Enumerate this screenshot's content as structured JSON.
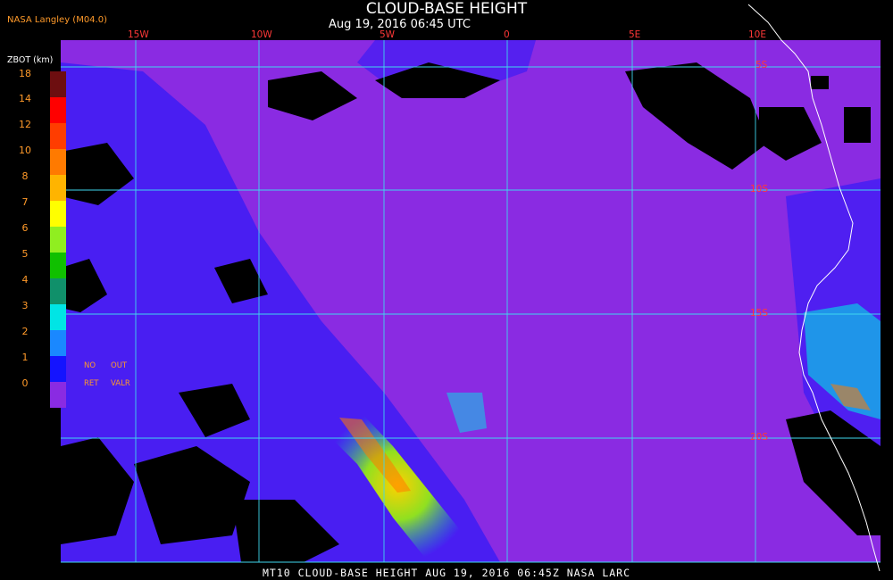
{
  "header": {
    "title": "CLOUD-BASE HEIGHT",
    "subtitle": "Aug 19, 2016 06:45 UTC",
    "source": "NASA Langley (M04.0)"
  },
  "footer": {
    "text": "MT10  CLOUD-BASE HEIGHT   AUG 19, 2016 06:45Z   NASA LARC"
  },
  "map": {
    "region": "South-East Atlantic / West Africa coast",
    "lon_labels": [
      "15W",
      "10W",
      "5W",
      "0",
      "5E",
      "10E"
    ],
    "lat_labels": [
      "5S",
      "10S",
      "15S",
      "20S"
    ],
    "grid_color": "#3fd7ee",
    "coast_color": "#ffffff",
    "background_color": "#8a2be2",
    "no_data_color": "#000000"
  },
  "colorbar": {
    "unit_label": "ZBOT (km)",
    "ticks": [
      "18",
      "14",
      "12",
      "10",
      "8",
      "7",
      "6",
      "5",
      "4",
      "3",
      "2",
      "1",
      "0"
    ],
    "colors": [
      "#6d0e10",
      "#ff0000",
      "#ff3d00",
      "#ff7a00",
      "#ffb400",
      "#ffff00",
      "#90ee20",
      "#10c000",
      "#10906a",
      "#00e5e5",
      "#1a88ff",
      "#1414ff",
      "#8a2be2"
    ],
    "no_retrieval_label": "NO RET",
    "out_of_range_label": "OUT VALR"
  }
}
